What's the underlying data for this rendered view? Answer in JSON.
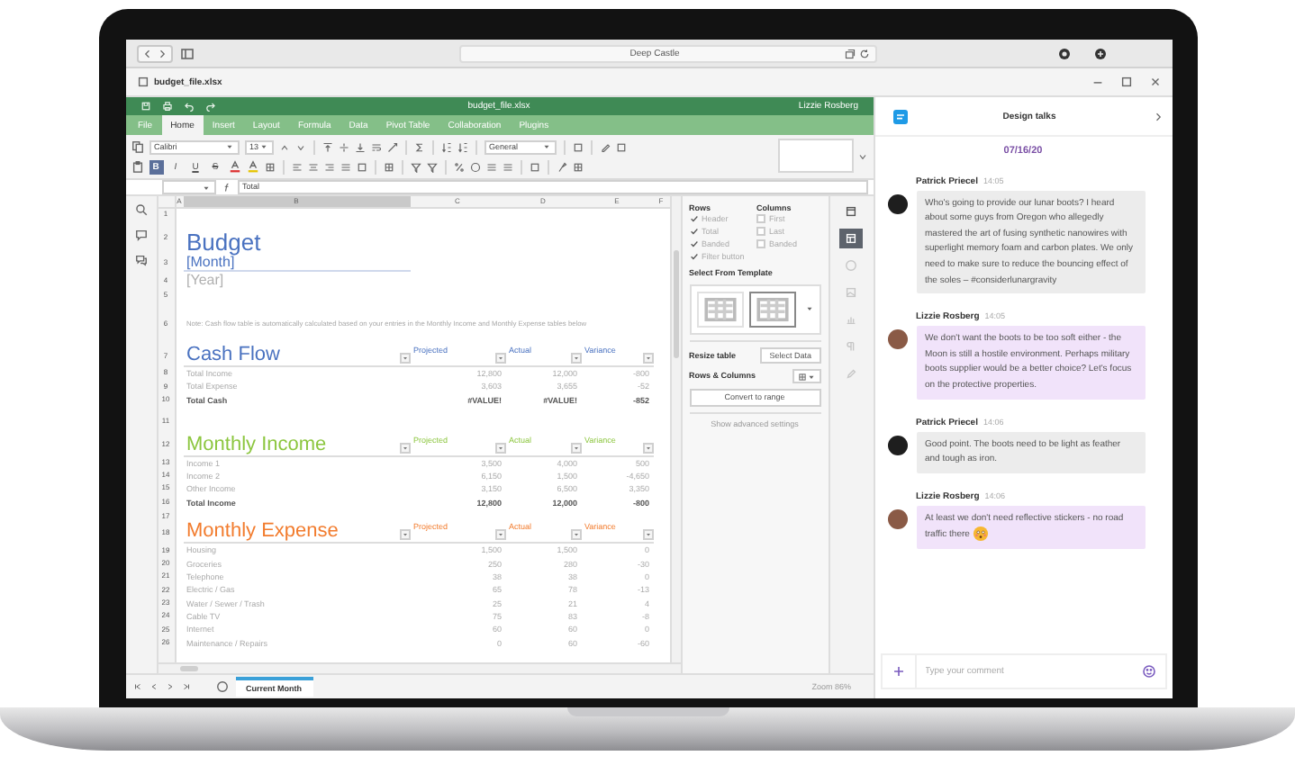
{
  "browser": {
    "address": "Deep Castle"
  },
  "document_tab": {
    "title": "budget_file.xlsx"
  },
  "editor": {
    "title": "budget_file.xlsx",
    "user": "Lizzie Rosberg",
    "menu_tabs": [
      {
        "label": "File",
        "selected": false
      },
      {
        "label": "Home",
        "selected": true
      },
      {
        "label": "Insert",
        "selected": false
      },
      {
        "label": "Layout",
        "selected": false
      },
      {
        "label": "Formula",
        "selected": false
      },
      {
        "label": "Data",
        "selected": false
      },
      {
        "label": "Pivot Table",
        "selected": false
      },
      {
        "label": "Collaboration",
        "selected": false
      },
      {
        "label": "Plugins",
        "selected": false
      }
    ],
    "toolbar": {
      "font": "Calibri",
      "font_size": "13",
      "number_format": "General",
      "format_buttons": [
        {
          "label": "B",
          "on": true
        },
        {
          "label": "I",
          "on": false
        },
        {
          "label": "U",
          "on": false
        },
        {
          "label": "S",
          "on": false
        }
      ]
    },
    "formula": "Total",
    "columns": [
      {
        "label": "A",
        "selected": false
      },
      {
        "label": "B",
        "selected": true
      },
      {
        "label": "C",
        "selected": false
      },
      {
        "label": "D",
        "selected": false
      },
      {
        "label": "E",
        "selected": false
      },
      {
        "label": "F",
        "selected": false
      }
    ],
    "rows": [
      {
        "num": "1",
        "kind": "blank"
      },
      {
        "num": "2",
        "kind": "title",
        "text": "Budget"
      },
      {
        "num": "3",
        "kind": "subtitle",
        "text": "[Month]"
      },
      {
        "num": "4",
        "kind": "subtitle_muted",
        "text": "[Year]"
      },
      {
        "num": "5",
        "kind": "blank"
      },
      {
        "num": "6",
        "kind": "note",
        "text": "Note: Cash flow table is automatically calculated based on your entries in the Monthly Income and Monthly Expense tables below"
      },
      {
        "num": "7",
        "kind": "section",
        "text": "Cash Flow",
        "color": "#4a72c0",
        "headers": [
          "Projected",
          "Actual",
          "Variance"
        ]
      },
      {
        "num": "8",
        "kind": "data",
        "cells": [
          "Total Income",
          "12,800",
          "12,000",
          "-800"
        ]
      },
      {
        "num": "9",
        "kind": "data",
        "cells": [
          "Total Expense",
          "3,603",
          "3,655",
          "-52"
        ]
      },
      {
        "num": "10",
        "kind": "total",
        "cells": [
          "Total Cash",
          "#VALUE!",
          "#VALUE!",
          "-852"
        ]
      },
      {
        "num": "11",
        "kind": "gap"
      },
      {
        "num": "12",
        "kind": "section",
        "text": "Monthly Income",
        "color": "#8cc63f",
        "headers": [
          "Projected",
          "Actual",
          "Variance"
        ]
      },
      {
        "num": "13",
        "kind": "data",
        "cells": [
          "Income 1",
          "3,500",
          "4,000",
          "500"
        ]
      },
      {
        "num": "14",
        "kind": "data",
        "cells": [
          "Income 2",
          "6,150",
          "1,500",
          "-4,650"
        ]
      },
      {
        "num": "15",
        "kind": "data",
        "cells": [
          "Other Income",
          "3,150",
          "6,500",
          "3,350"
        ]
      },
      {
        "num": "16",
        "kind": "total",
        "cells": [
          "Total Income",
          "12,800",
          "12,000",
          "-800"
        ]
      },
      {
        "num": "17",
        "kind": "blank"
      },
      {
        "num": "18",
        "kind": "section",
        "text": "Monthly Expense",
        "color": "#f27c2e",
        "headers": [
          "Projected",
          "Actual",
          "Variance"
        ]
      },
      {
        "num": "19",
        "kind": "data",
        "cells": [
          "Housing",
          "1,500",
          "1,500",
          "0"
        ]
      },
      {
        "num": "20",
        "kind": "data",
        "cells": [
          "Groceries",
          "250",
          "280",
          "-30"
        ]
      },
      {
        "num": "21",
        "kind": "data",
        "cells": [
          "Telephone",
          "38",
          "38",
          "0"
        ]
      },
      {
        "num": "22",
        "kind": "data",
        "cells": [
          "Electric / Gas",
          "65",
          "78",
          "-13"
        ]
      },
      {
        "num": "23",
        "kind": "data",
        "cells": [
          "Water / Sewer / Trash",
          "25",
          "21",
          "4"
        ]
      },
      {
        "num": "24",
        "kind": "data",
        "cells": [
          "Cable TV",
          "75",
          "83",
          "-8"
        ]
      },
      {
        "num": "25",
        "kind": "data",
        "cells": [
          "Internet",
          "60",
          "60",
          "0"
        ]
      },
      {
        "num": "26",
        "kind": "data",
        "cells": [
          "Maintenance / Repairs",
          "0",
          "60",
          "-60"
        ]
      }
    ],
    "table_settings": {
      "rows_title": "Rows",
      "columns_title": "Columns",
      "row_options": [
        {
          "label": "Header",
          "checked": true
        },
        {
          "label": "Total",
          "checked": true
        },
        {
          "label": "Banded",
          "checked": true
        },
        {
          "label": "Filter button",
          "checked": true
        }
      ],
      "column_options": [
        {
          "label": "First",
          "checked": false
        },
        {
          "label": "Last",
          "checked": false
        },
        {
          "label": "Banded",
          "checked": false
        }
      ],
      "template_title": "Select From Template",
      "templates": [
        {
          "selected": false
        },
        {
          "selected": true
        }
      ],
      "resize_label": "Resize table",
      "select_data": "Select Data",
      "rows_columns_label": "Rows & Columns",
      "convert": "Convert to range",
      "advanced": "Show advanced settings"
    },
    "side_icons": [
      {
        "selected": false,
        "disabled": false
      },
      {
        "selected": true,
        "disabled": false
      },
      {
        "selected": false,
        "disabled": true
      },
      {
        "selected": false,
        "disabled": true
      },
      {
        "selected": false,
        "disabled": true
      },
      {
        "selected": false,
        "disabled": true
      },
      {
        "selected": false,
        "disabled": true
      }
    ],
    "sheets": [
      {
        "label": "Current Month",
        "selected": true
      }
    ],
    "zoom": "Zoom 86%"
  },
  "chat": {
    "title": "Design talks",
    "date": "07/16/20",
    "messages": [
      {
        "author": "Patrick Priecel",
        "time": "14:05",
        "own": false,
        "color": "#1e1e1e",
        "emoji": false,
        "text": "Who's going to provide our lunar boots? I heard about some guys from Oregon who allegedly mastered the art of fusing synthetic nanowires with superlight memory foam and carbon plates. We only need to make sure to reduce the bouncing effect of the soles – #considerlunargravity"
      },
      {
        "author": "Lizzie Rosberg",
        "time": "14:05",
        "own": true,
        "color": "#8a5a46",
        "emoji": false,
        "text": "We don't want the boots to be too soft either - the Moon is still a hostile environment. Perhaps military boots supplier would be a better choice? Let's focus on the protective properties."
      },
      {
        "author": "Patrick Priecel",
        "time": "14:06",
        "own": false,
        "color": "#1e1e1e",
        "emoji": false,
        "text": "Good point. The boots need to be light as feather and tough as iron."
      },
      {
        "author": "Lizzie Rosberg",
        "time": "14:06",
        "own": true,
        "color": "#8a5a46",
        "emoji": true,
        "text": "At least we don't need reflective stickers - no road traffic there"
      }
    ],
    "input_placeholder": "Type your comment"
  }
}
